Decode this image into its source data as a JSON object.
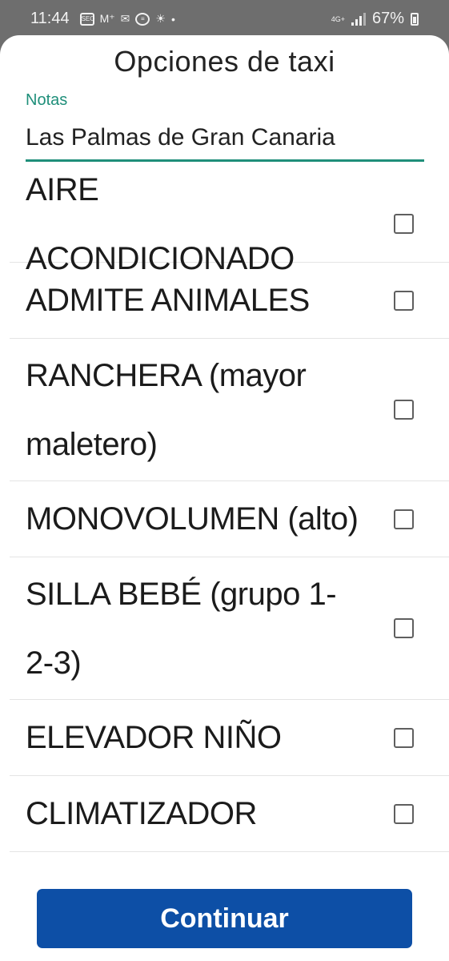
{
  "status_bar": {
    "time": "11:44",
    "battery_percent": "67%",
    "network": "4G+",
    "icons": [
      "seo-icon",
      "movistar-icon",
      "gmail-icon",
      "messages-icon",
      "weather-icon",
      "dot-icon"
    ]
  },
  "sheet": {
    "title": "Opciones de taxi",
    "notes": {
      "label": "Notas",
      "value": "Las Palmas de Gran Canaria"
    },
    "options": [
      {
        "label": "AIRE ACONDICIONADO",
        "checked": false
      },
      {
        "label": "ADMITE ANIMALES",
        "checked": false
      },
      {
        "label": "RANCHERA (mayor maletero)",
        "checked": false
      },
      {
        "label": "MONOVOLUMEN (alto)",
        "checked": false
      },
      {
        "label": "SILLA BEBÉ (grupo 1-2-3)",
        "checked": false
      },
      {
        "label": "ELEVADOR NIÑO",
        "checked": false
      },
      {
        "label": "CLIMATIZADOR",
        "checked": false
      }
    ],
    "continue_label": "Continuar"
  },
  "colors": {
    "accent": "#1f8f7a",
    "button": "#0d4fa6",
    "status_bar": "#6e6e6e"
  }
}
